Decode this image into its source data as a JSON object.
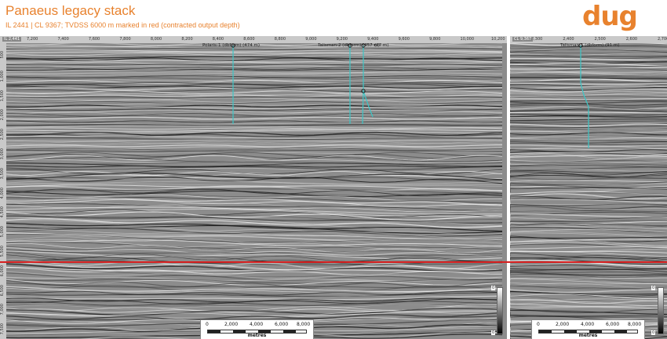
{
  "header": {
    "title": "Panaeus legacy stack",
    "subtitle": "IL 2441 | CL 9367; TVDSS 6000 m marked in red (contracted output depth)",
    "logo": "dug"
  },
  "panel_il": {
    "line_label": "IL 2,441",
    "x_ticks": [
      "7,200",
      "7,400",
      "7,600",
      "7,800",
      "8,000",
      "8,200",
      "8,400",
      "8,600",
      "8,800",
      "9,000",
      "9,200",
      "9,400",
      "9,600",
      "9,800",
      "10,000",
      "10,200"
    ],
    "y_ticks": [
      "500",
      "1,000",
      "1,500",
      "2,000",
      "2,500",
      "3,000",
      "3,500",
      "4,000",
      "4,500",
      "5,000",
      "5,500",
      "6,000",
      "6,500",
      "7,000",
      "7,500"
    ],
    "y_unit": "TVDSS m",
    "wells": [
      {
        "label": "Polaris-1 (dbform) (474 m)"
      },
      {
        "label": "Talisman-2 (dbform) (457 m)"
      },
      {
        "label": "(27 m)"
      }
    ],
    "scalebar": {
      "ticks": [
        "0",
        "2,000",
        "4,000",
        "6,000",
        "8,000"
      ],
      "unit": "metres"
    },
    "colorbar": {
      "top": "0",
      "bottom": "0"
    }
  },
  "panel_cl": {
    "line_label": "CL 9,367",
    "x_ticks": [
      "2,300",
      "2,400",
      "2,500",
      "2,600",
      "2,700"
    ],
    "wells": [
      {
        "label": "Talisman-1 (dbform) (91 m)"
      }
    ],
    "scalebar": {
      "ticks": [
        "0",
        "2,000",
        "4,000",
        "6,000",
        "8,000"
      ],
      "unit": "metres"
    },
    "colorbar": {
      "top": "0",
      "bottom": "0"
    }
  },
  "colors": {
    "accent": "#e8822e",
    "well": "#3cc6c6",
    "depth_marker": "#d61f1f"
  }
}
